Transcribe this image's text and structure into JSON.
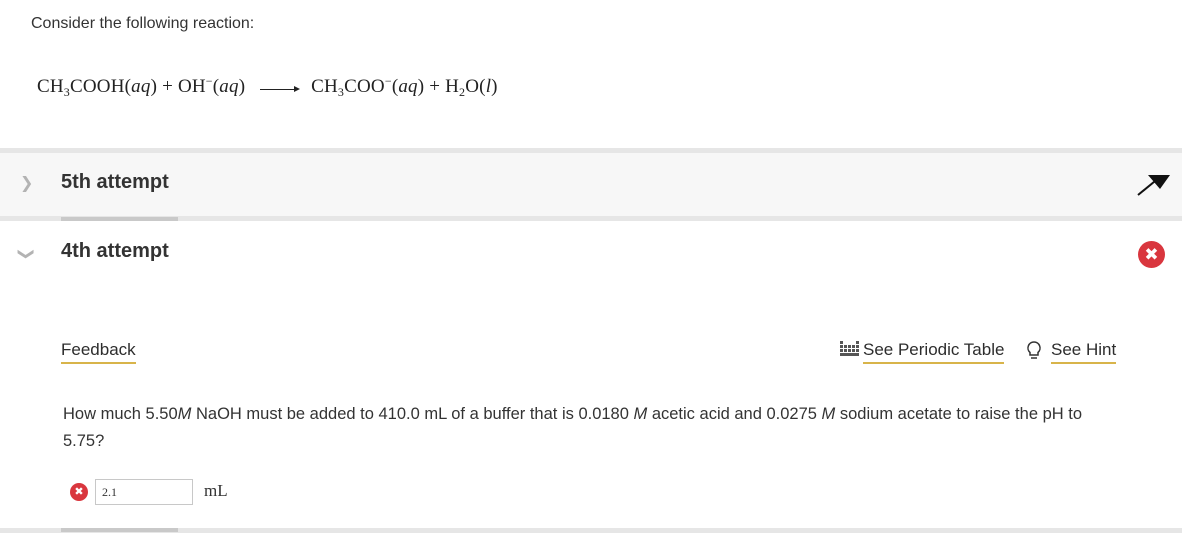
{
  "intro": "Consider the following reaction:",
  "equation": {
    "left": [
      {
        "base": "CH",
        "sub": "3",
        "rest": "COOH"
      },
      {
        "state": "aq"
      },
      {
        "plus": "+"
      },
      {
        "base": "OH",
        "sup": "−"
      },
      {
        "state": "aq"
      }
    ],
    "text_left_1": "CH",
    "sub_1": "3",
    "text_left_2": "COOH",
    "state_1": "aq",
    "plus_1": "+",
    "text_left_3": "OH",
    "sup_1": "−",
    "state_2": "aq",
    "text_right_1": "CH",
    "sub_2": "3",
    "text_right_2": "COO",
    "sup_2": "−",
    "state_3": "aq",
    "plus_2": "+",
    "text_right_3": "H",
    "sub_3": "2",
    "text_right_4": "O",
    "state_4": "l"
  },
  "attempts": [
    {
      "title": "5th attempt",
      "state": "collapsed",
      "accent": "#e8613c"
    },
    {
      "title": "4th attempt",
      "state": "expanded",
      "accent": "#c9c9c9"
    }
  ],
  "links": {
    "feedback": "Feedback",
    "periodic_table": "See Periodic Table",
    "hint": "See Hint"
  },
  "question": {
    "part1": "How much 5.50",
    "M1": "M",
    "part2": " NaOH must be added to 410.0 mL of a buffer that is 0.0180 ",
    "M2": "M",
    "part3": " acetic acid and 0.0275 ",
    "M3": "M",
    "part4": " sodium acetate to raise the pH to 5.75?"
  },
  "answer": {
    "value": "2.1",
    "unit": "mL",
    "status": "incorrect"
  },
  "colors": {
    "error": "#d9363e",
    "link_underline": "#d8b44a"
  }
}
